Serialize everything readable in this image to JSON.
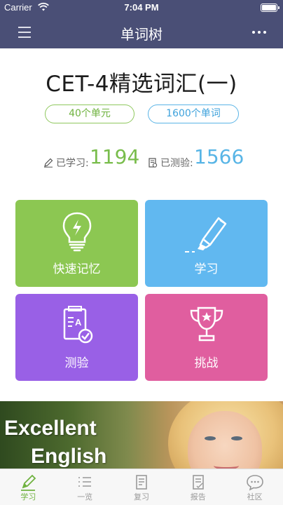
{
  "status_bar": {
    "carrier": "Carrier",
    "time": "7:04 PM"
  },
  "nav": {
    "title": "单词树",
    "menu_icon": "hamburger-menu-icon",
    "more_icon": "more-dots-icon"
  },
  "book": {
    "title": "CET-4精选词汇(一)",
    "units_label": "40个单元",
    "words_label": "1600个单词"
  },
  "stats": {
    "learned_label": "已学习:",
    "learned_value": "1194",
    "tested_label": "已测验:",
    "tested_value": "1566"
  },
  "tiles": [
    {
      "label": "快速记忆",
      "icon": "lightbulb-icon",
      "color": "#8cc752"
    },
    {
      "label": "学习",
      "icon": "highlighter-icon",
      "color": "#61b8f0"
    },
    {
      "label": "测验",
      "icon": "quiz-clipboard-icon",
      "color": "#9960e6"
    },
    {
      "label": "挑战",
      "icon": "trophy-icon",
      "color": "#e05e9f"
    }
  ],
  "banner": {
    "line1": "Excellent",
    "line2": "English"
  },
  "tabbar": {
    "active_color": "#6fb23f",
    "items": [
      {
        "label": "学习",
        "icon": "pen-icon"
      },
      {
        "label": "一览",
        "icon": "list-icon"
      },
      {
        "label": "复习",
        "icon": "document-icon"
      },
      {
        "label": "报告",
        "icon": "report-icon"
      },
      {
        "label": "社区",
        "icon": "chat-bubble-icon"
      }
    ]
  }
}
